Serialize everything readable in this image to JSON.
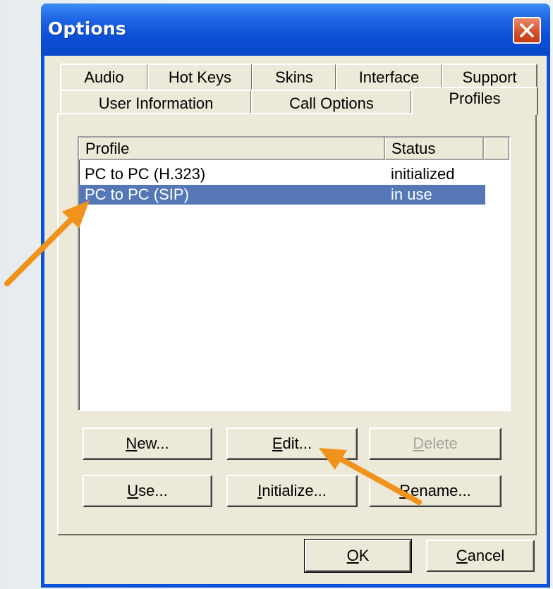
{
  "window": {
    "title": "Options"
  },
  "tabs": {
    "row1": [
      "Audio",
      "Hot Keys",
      "Skins",
      "Interface",
      "Support"
    ],
    "row2": [
      "User Information",
      "Call Options",
      "Profiles"
    ],
    "selected": "Profiles"
  },
  "profiles_list": {
    "columns": [
      "Profile",
      "Status"
    ],
    "rows": [
      {
        "profile": "PC to PC (H.323)",
        "status": "initialized",
        "selected": false
      },
      {
        "profile": "PC to PC (SIP)",
        "status": "in use",
        "selected": true
      }
    ]
  },
  "buttons": {
    "new": {
      "mnemonic": "N",
      "rest": "ew..."
    },
    "edit": {
      "mnemonic": "E",
      "rest": "dit..."
    },
    "delete": {
      "mnemonic": "D",
      "rest": "elete"
    },
    "use": {
      "mnemonic": "U",
      "rest": "se..."
    },
    "initialize": {
      "mnemonic": "I",
      "rest": "nitialize..."
    },
    "rename": {
      "mnemonic": "R",
      "rest": "ename..."
    },
    "ok": {
      "mnemonic": "O",
      "rest": "K"
    },
    "cancel": {
      "mnemonic": "C",
      "rest": "ancel"
    }
  },
  "colors": {
    "title_bar": "#0b4fd6",
    "face": "#ece9d8",
    "selection": "#5577b6",
    "annotation_arrow": "#f0921c"
  },
  "icons": [
    "close-icon"
  ]
}
